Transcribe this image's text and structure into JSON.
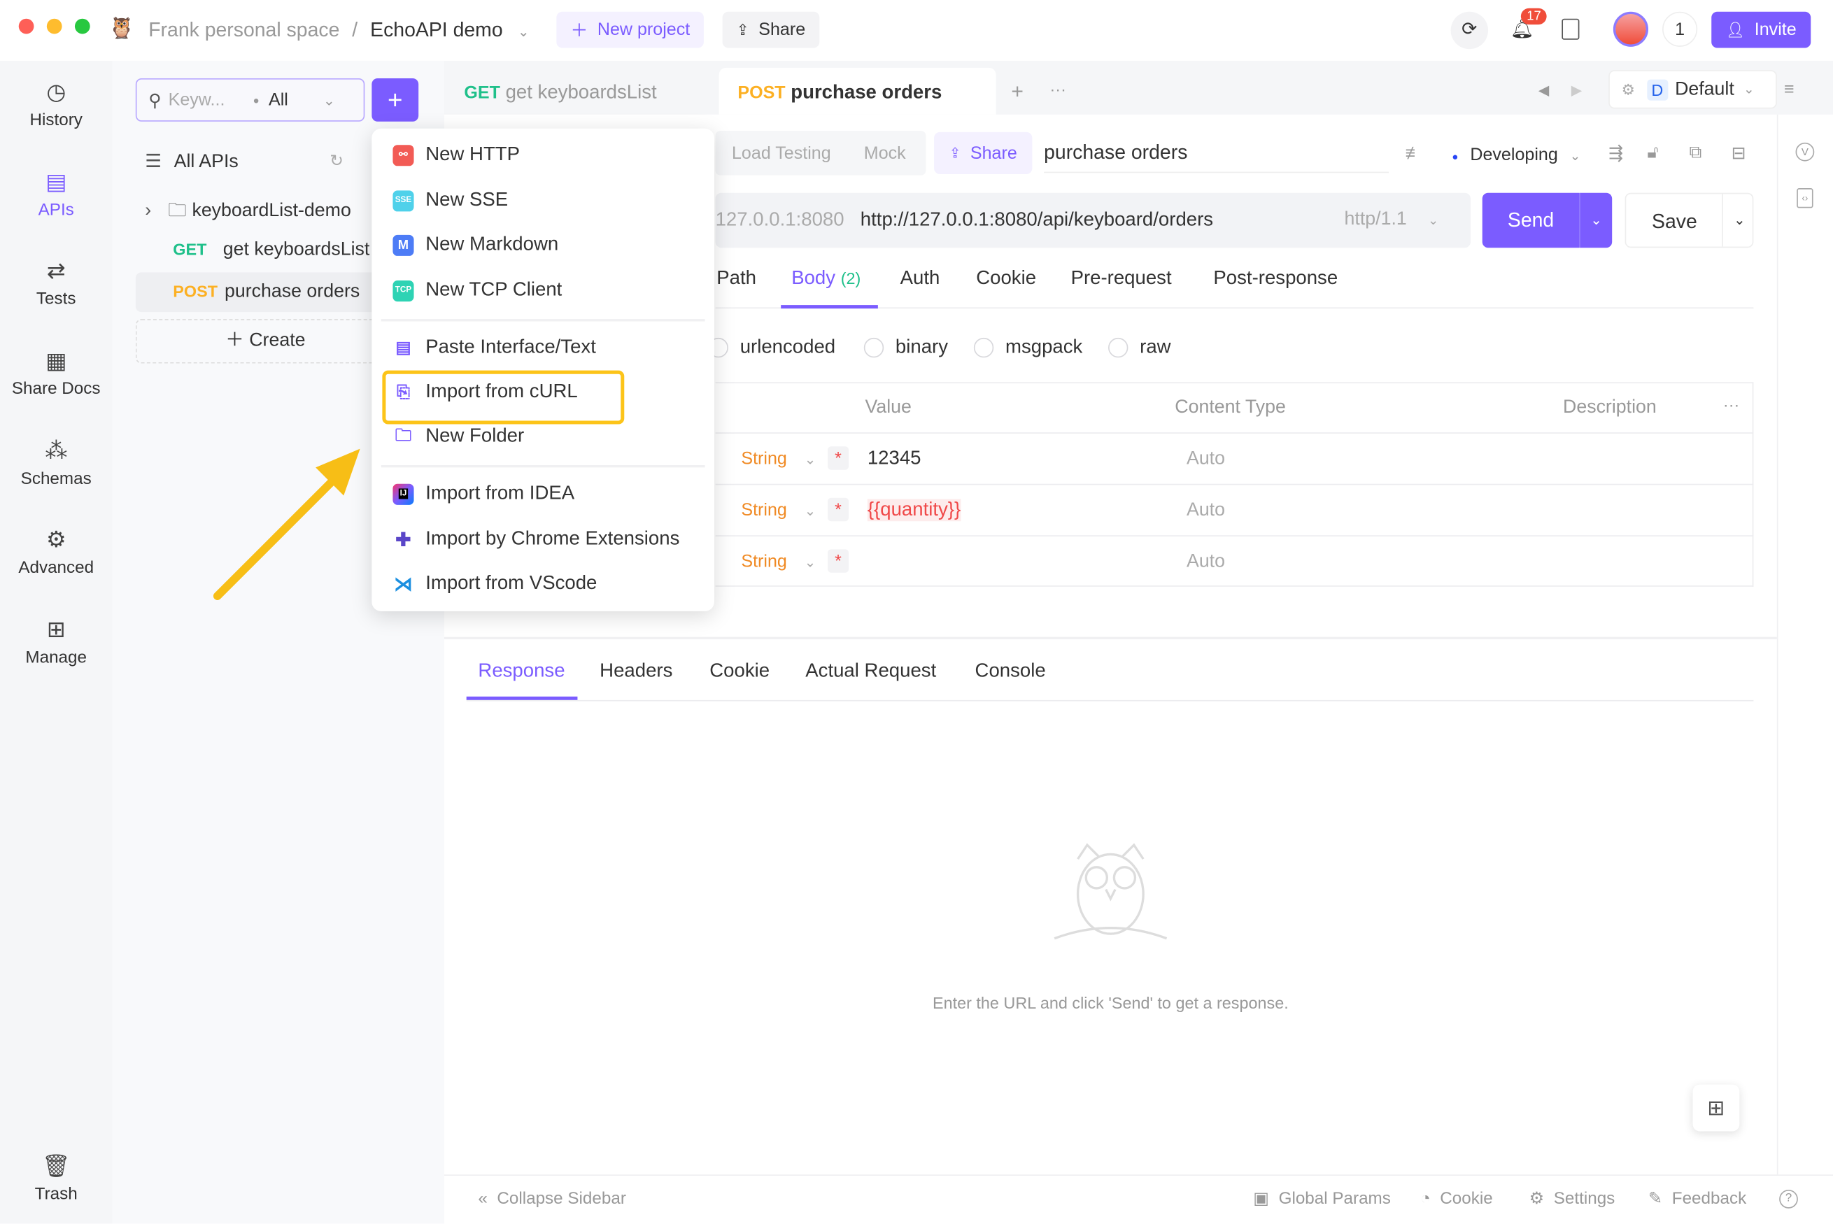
{
  "window": {
    "traffic_lights": [
      "#fe5f57",
      "#febc2e",
      "#28c840"
    ]
  },
  "header": {
    "workspace": "Frank personal space",
    "separator": "/",
    "project": "EchoAPI demo",
    "new_project": "New project",
    "share": "Share",
    "notification_count": "17",
    "member_count": "1",
    "invite": "Invite",
    "accent": "#7b5cff"
  },
  "nav": {
    "items": [
      {
        "label": "History",
        "icon": "history-icon"
      },
      {
        "label": "APIs",
        "icon": "apis-icon",
        "active": true
      },
      {
        "label": "Tests",
        "icon": "tests-icon"
      },
      {
        "label": "Share Docs",
        "icon": "share-docs-icon"
      },
      {
        "label": "Schemas",
        "icon": "schemas-icon"
      },
      {
        "label": "Advanced",
        "icon": "advanced-icon"
      },
      {
        "label": "Manage",
        "icon": "manage-icon"
      }
    ],
    "trash": "Trash"
  },
  "sidebar": {
    "search_placeholder": "Keyw...",
    "filter": "All",
    "all_apis": "All APIs",
    "folder": "keyboardList-demo",
    "items": [
      {
        "method": "GET",
        "name": "get keyboardsList"
      },
      {
        "method": "POST",
        "name": "purchase orders"
      }
    ],
    "create": "Create"
  },
  "tabs": [
    {
      "method": "GET",
      "name": "get keyboardsList"
    },
    {
      "method": "POST",
      "name": "purchase orders",
      "active": true
    }
  ],
  "environment": {
    "badge": "D",
    "name": "Default"
  },
  "request": {
    "subtabs": [
      "Load Testing",
      "Mock"
    ],
    "share": "Share",
    "name": "purchase orders",
    "status": "Developing",
    "host": "127.0.0.1:8080",
    "url": "http://127.0.0.1:8080/api/keyboard/orders",
    "protocol": "http/1.1",
    "send": "Send",
    "save": "Save",
    "param_tabs": [
      "Path",
      "Body",
      "Auth",
      "Cookie",
      "Pre-request",
      "Post-response"
    ],
    "body_count": "(2)",
    "body_types": [
      "urlencoded",
      "binary",
      "msgpack",
      "raw"
    ],
    "columns": [
      "Value",
      "Content Type",
      "Description"
    ],
    "rows": [
      {
        "type": "String",
        "value": "12345",
        "content_type": "Auto"
      },
      {
        "type": "String",
        "value": "{{quantity}}",
        "content_type": "Auto"
      },
      {
        "type": "String",
        "value": "",
        "content_type": "Auto"
      }
    ]
  },
  "response": {
    "tabs": [
      "Response",
      "Headers",
      "Cookie",
      "Actual Request",
      "Console"
    ],
    "empty_text": "Enter the URL and click 'Send' to get a response."
  },
  "menu": {
    "items": [
      {
        "label": "New HTTP",
        "icon": "http-icon",
        "color": "#f25b55"
      },
      {
        "label": "New SSE",
        "icon": "sse-icon",
        "color": "#4fd1ea"
      },
      {
        "label": "New Markdown",
        "icon": "markdown-icon",
        "color": "#4d7cf6"
      },
      {
        "label": "New TCP Client",
        "icon": "tcp-icon",
        "color": "#2ed3b4"
      },
      {
        "label": "Paste Interface/Text",
        "icon": "paste-icon"
      },
      {
        "label": "Import from cURL",
        "icon": "import-curl-icon",
        "highlighted": true
      },
      {
        "label": "New Folder",
        "icon": "new-folder-icon"
      },
      {
        "label": "Import from IDEA",
        "icon": "idea-icon"
      },
      {
        "label": "Import by Chrome Extensions",
        "icon": "chrome-extension-icon"
      },
      {
        "label": "Import from VScode",
        "icon": "vscode-icon"
      }
    ],
    "highlight_color": "#fcc419"
  },
  "footer": {
    "collapse": "Collapse Sidebar",
    "global_params": "Global Params",
    "cookie": "Cookie",
    "settings": "Settings",
    "feedback": "Feedback"
  }
}
